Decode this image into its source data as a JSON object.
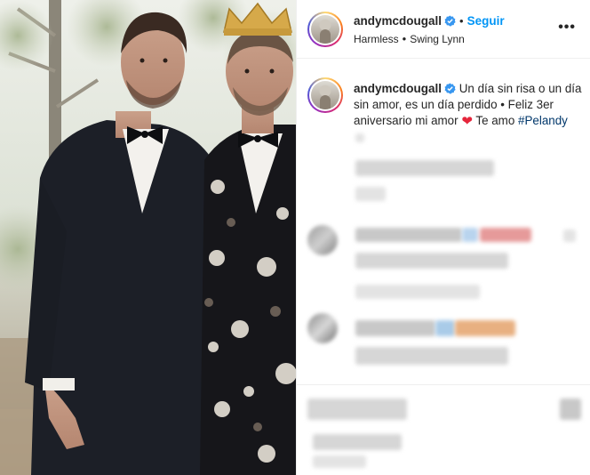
{
  "post": {
    "author": {
      "username": "andymcdougall",
      "verified": true,
      "follow_label": "Seguir",
      "audio_artist": "Harmless",
      "audio_track": "Swing Lynn",
      "separator": "•",
      "more_icon": "more-options-icon"
    },
    "caption": {
      "username": "andymcdougall",
      "text_before_heart": "Un día sin risa o un día sin amor, es un día perdido • Feliz 3er aniversario mi amor",
      "heart_glyph": "❤",
      "text_after_heart": "Te amo",
      "hashtag": "#Pelandy"
    }
  },
  "colors": {
    "link": "#0095f6",
    "hashtag": "#00376b",
    "heart": "#e5253b",
    "verified": "#3897f0"
  }
}
